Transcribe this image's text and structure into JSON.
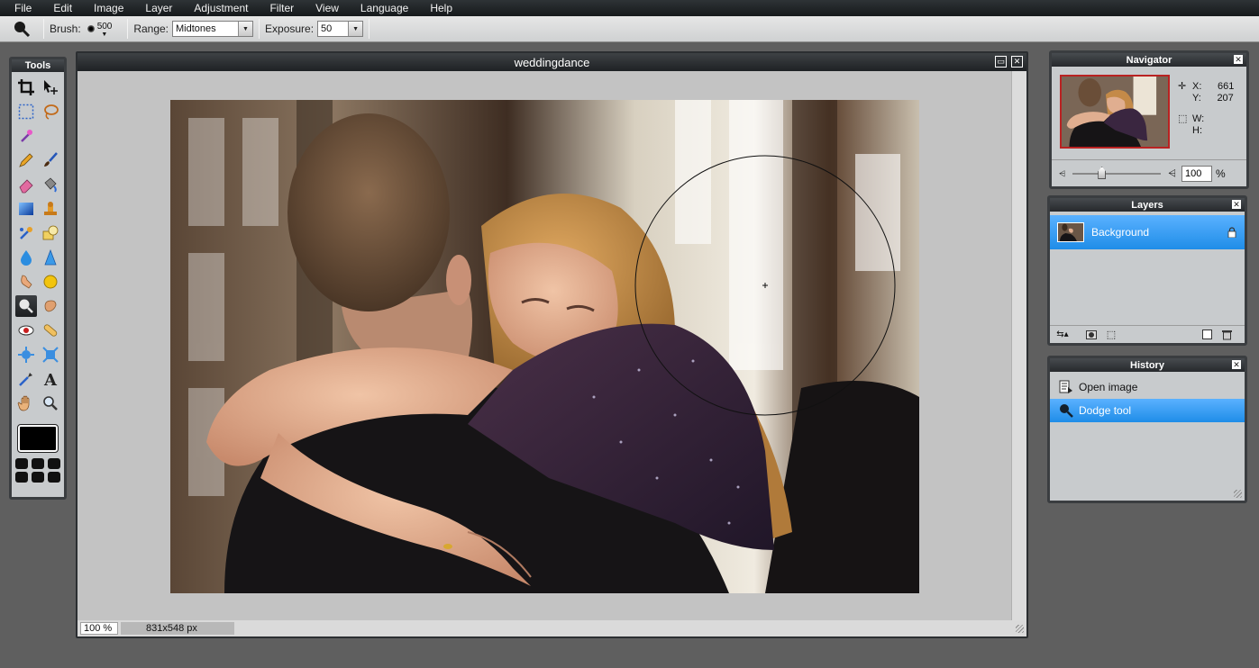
{
  "menubar": {
    "items": [
      "File",
      "Edit",
      "Image",
      "Layer",
      "Adjustment",
      "Filter",
      "View",
      "Language",
      "Help"
    ]
  },
  "options": {
    "brush_label": "Brush:",
    "brush_size": "500",
    "range_label": "Range:",
    "range_value": "Midtones",
    "exposure_label": "Exposure:",
    "exposure_value": "50"
  },
  "tools": {
    "title": "Tools",
    "active_tool": "dodge-tool",
    "primary_color": "#000000"
  },
  "document": {
    "title": "weddingdance",
    "zoom": "100 %",
    "dimensions": "831x548 px"
  },
  "navigator": {
    "title": "Navigator",
    "x_label": "X:",
    "x_value": "661",
    "y_label": "Y:",
    "y_value": "207",
    "w_label": "W:",
    "w_value": "",
    "h_label": "H:",
    "h_value": "",
    "zoom_value": "100",
    "zoom_unit": "%"
  },
  "layers": {
    "title": "Layers",
    "items": [
      {
        "name": "Background",
        "locked": true,
        "selected": true
      }
    ]
  },
  "history": {
    "title": "History",
    "items": [
      {
        "label": "Open image",
        "icon": "document-icon",
        "active": false
      },
      {
        "label": "Dodge tool",
        "icon": "dodge-icon",
        "active": true
      }
    ]
  },
  "colors": {
    "accent": "#2b93ef",
    "panel_bg": "#c8cbcd",
    "app_bg": "#5f5f5f"
  }
}
